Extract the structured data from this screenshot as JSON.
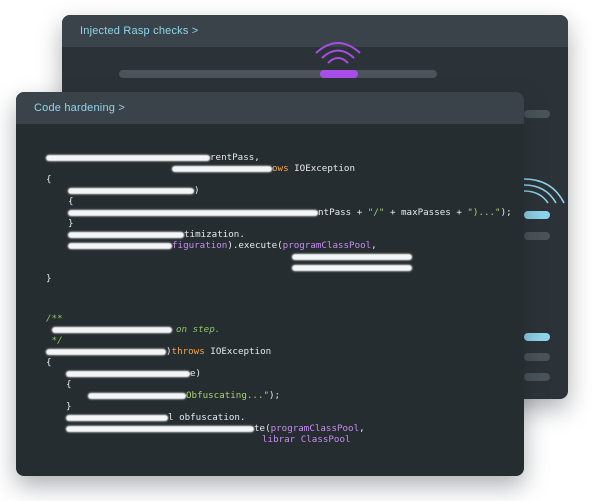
{
  "back_window": {
    "title": "Injected Rasp checks >"
  },
  "front_window": {
    "title": "Code hardening >",
    "code": {
      "l1": "rentPass,",
      "l2_kw": "ows",
      "l2_rest": " IOException",
      "l3": "{",
      "l4": ")",
      "l5": "{",
      "l6_a": "ntPass + ",
      "l6_str": "\"/\"",
      "l6_b": " + maxPasses + ",
      "l6_str2": "\")...\"",
      "l6_c": ");",
      "l7": "}",
      "l8": "timization.",
      "l9_a": "figuration",
      "l9_b": ").execute(",
      "l9_fn": "programClassPool",
      "l9_c": ",",
      "l10": "}",
      "c1": "/**",
      "c2": "on step.",
      "c3": " */",
      "l11_a": ")",
      "l11_kw": "throws",
      "l11_b": " IOException",
      "l12": "{",
      "l13": "e)",
      "l14": "{",
      "l15_str": "Obfuscating...\"",
      "l15_b": ");",
      "l16": "}",
      "l17": "l obfuscation.",
      "l18_a": "te(",
      "l18_fn": "programClassPool",
      "l18_b": ",",
      "l19_fn": "librar ClassPool"
    }
  },
  "colors": {
    "accent_blue": "#8fd6ec",
    "accent_purple": "#a94de8",
    "keyword_orange": "#f2a54b",
    "string_green": "#a8d272"
  }
}
